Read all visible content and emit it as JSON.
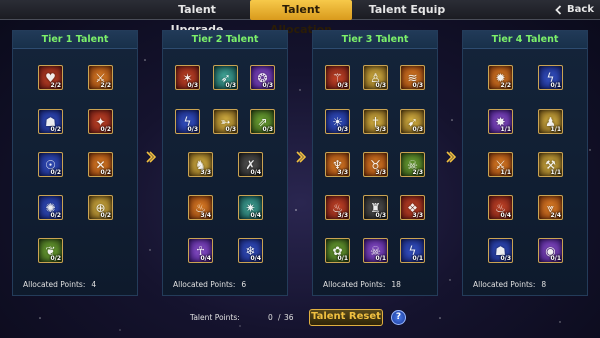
{
  "tabs": [
    {
      "label": "Talent Upgrade",
      "active": false
    },
    {
      "label": "Talent Allocation",
      "active": true
    },
    {
      "label": "Talent Equip",
      "active": false
    }
  ],
  "back_label": "Back",
  "panels": [
    {
      "title": "Tier 1 Talent",
      "allocated_label": "Allocated Points:",
      "allocated_value": "4",
      "icons": [
        {
          "name": "heart-icon",
          "glyph": "♥",
          "color": "c-red",
          "points": "2/2"
        },
        {
          "name": "sword-slash-icon",
          "glyph": "⚔",
          "color": "c-orange",
          "points": "2/2"
        },
        {
          "name": "hooded-mage-icon",
          "glyph": "☗",
          "color": "c-blue",
          "points": "0/2"
        },
        {
          "name": "blade-burst-icon",
          "glyph": "✦",
          "color": "c-red",
          "points": "0/2"
        },
        {
          "name": "shield-guard-icon",
          "glyph": "☉",
          "color": "c-blue",
          "points": "0/2"
        },
        {
          "name": "claw-strike-icon",
          "glyph": "✕",
          "color": "c-orange",
          "points": "0/2"
        },
        {
          "name": "light-burst-icon",
          "glyph": "✺",
          "color": "c-blue",
          "points": "0/2"
        },
        {
          "name": "target-icon",
          "glyph": "⊕",
          "color": "c-gold",
          "points": "0/2"
        },
        {
          "name": "green-beast-icon",
          "glyph": "❦",
          "color": "c-green",
          "points": "0/2"
        }
      ]
    },
    {
      "title": "Tier 2 Talent",
      "allocated_label": "Allocated Points:",
      "allocated_value": "6",
      "icons": [
        {
          "name": "fire-slash-icon",
          "glyph": "✶",
          "color": "c-red",
          "points": "0/3"
        },
        {
          "name": "wind-blade-icon",
          "glyph": "➶",
          "color": "c-teal",
          "points": "0/3"
        },
        {
          "name": "arcane-swirl-icon",
          "glyph": "❂",
          "color": "c-purple",
          "points": "0/3"
        },
        {
          "name": "lightning-icon",
          "glyph": "ϟ",
          "color": "c-blue",
          "points": "0/3"
        },
        {
          "name": "bow-icon",
          "glyph": "➳",
          "color": "c-gold",
          "points": "0/3"
        },
        {
          "name": "arrow-volley-icon",
          "glyph": "⇗",
          "color": "c-green",
          "points": "0/3"
        },
        {
          "name": "warrior-icon",
          "glyph": "♞",
          "color": "c-gold",
          "points": "3/3"
        },
        {
          "name": "blood-strike-icon",
          "glyph": "✗",
          "color": "c-dark",
          "points": "0/4"
        },
        {
          "name": "flame-icon",
          "glyph": "♨",
          "color": "c-orange",
          "points": "3/4"
        },
        {
          "name": "star-burst-icon",
          "glyph": "✷",
          "color": "c-teal",
          "points": "0/4"
        },
        {
          "name": "summoner-icon",
          "glyph": "☥",
          "color": "c-purple",
          "points": "0/4"
        },
        {
          "name": "storm-icon",
          "glyph": "❄",
          "color": "c-blue",
          "points": "0/4"
        }
      ]
    },
    {
      "title": "Tier 3 Talent",
      "allocated_label": "Allocated Points:",
      "allocated_value": "18",
      "icons": [
        {
          "name": "blade-icon",
          "glyph": "⚚",
          "color": "c-red",
          "points": "0/3"
        },
        {
          "name": "figure-icon",
          "glyph": "♙",
          "color": "c-gold",
          "points": "0/3"
        },
        {
          "name": "claw-marks-icon",
          "glyph": "≋",
          "color": "c-orange",
          "points": "0/3"
        },
        {
          "name": "sun-icon",
          "glyph": "☀",
          "color": "c-blue",
          "points": "0/3"
        },
        {
          "name": "twin-daggers-icon",
          "glyph": "†",
          "color": "c-gold",
          "points": "3/3"
        },
        {
          "name": "spear-thrust-icon",
          "glyph": "➹",
          "color": "c-gold",
          "points": "0/3"
        },
        {
          "name": "fire-pillar-icon",
          "glyph": "♆",
          "color": "c-orange",
          "points": "3/3"
        },
        {
          "name": "horned-helm-icon",
          "glyph": "♉",
          "color": "c-orange",
          "points": "3/3"
        },
        {
          "name": "monster-icon",
          "glyph": "☠",
          "color": "c-green",
          "points": "2/3"
        },
        {
          "name": "inferno-icon",
          "glyph": "♨",
          "color": "c-red",
          "points": "3/3"
        },
        {
          "name": "dark-knight-icon",
          "glyph": "♜",
          "color": "c-dark",
          "points": "0/3"
        },
        {
          "name": "phoenix-icon",
          "glyph": "❖",
          "color": "c-red",
          "points": "3/3"
        },
        {
          "name": "poison-icon",
          "glyph": "✿",
          "color": "c-green",
          "points": "0/1"
        },
        {
          "name": "skull-icon",
          "glyph": "☠",
          "color": "c-purple",
          "points": "0/1"
        },
        {
          "name": "spark-icon",
          "glyph": "ϟ",
          "color": "c-blue",
          "points": "0/1"
        }
      ]
    },
    {
      "title": "Tier 4 Talent",
      "allocated_label": "Allocated Points:",
      "allocated_value": "8",
      "icons": [
        {
          "name": "explosion-icon",
          "glyph": "✹",
          "color": "c-orange",
          "points": "2/2"
        },
        {
          "name": "chain-lightning-icon",
          "glyph": "ϟ",
          "color": "c-blue",
          "points": "0/1"
        },
        {
          "name": "shadow-blast-icon",
          "glyph": "✸",
          "color": "c-purple",
          "points": "1/1"
        },
        {
          "name": "warrior-stance-icon",
          "glyph": "♟",
          "color": "c-gold",
          "points": "1/1"
        },
        {
          "name": "fire-sword-icon",
          "glyph": "⚔",
          "color": "c-orange",
          "points": "1/1"
        },
        {
          "name": "hammer-icon",
          "glyph": "⚒",
          "color": "c-gold",
          "points": "1/1"
        },
        {
          "name": "flame-warrior-icon",
          "glyph": "♨",
          "color": "c-red",
          "points": "0/4"
        },
        {
          "name": "fang-icon",
          "glyph": "⩔",
          "color": "c-orange",
          "points": "2/4"
        },
        {
          "name": "ghost-icon",
          "glyph": "☗",
          "color": "c-blue",
          "points": "0/3"
        },
        {
          "name": "void-orb-icon",
          "glyph": "◉",
          "color": "c-purple",
          "points": "0/1"
        }
      ]
    }
  ],
  "talent_points_label": "Talent Points:",
  "talent_points_value": "0",
  "talent_points_sep": "/",
  "talent_points_total": "36",
  "reset_label": "Talent Reset",
  "help_label": "?"
}
